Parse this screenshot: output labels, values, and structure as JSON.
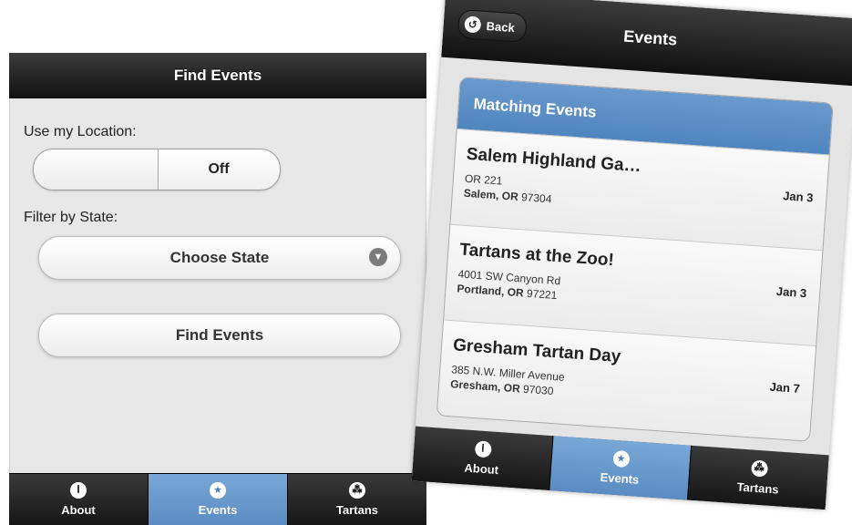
{
  "left_screen": {
    "header_title": "Find Events",
    "location_label": "Use my Location:",
    "location_toggle_state": "Off",
    "state_label": "Filter by State:",
    "state_select_value": "Choose State",
    "find_button_label": "Find Events",
    "tabs": [
      {
        "label": "About",
        "icon": "info-icon",
        "active": false
      },
      {
        "label": "Events",
        "icon": "star-icon",
        "active": true
      },
      {
        "label": "Tartans",
        "icon": "grid-icon",
        "active": false
      }
    ]
  },
  "right_screen": {
    "back_label": "Back",
    "header_title": "Events",
    "list_header": "Matching Events",
    "events": [
      {
        "title": "Salem Highland Ga…",
        "address": "OR 221",
        "city": "Salem, OR",
        "zip": "97304",
        "date": "Jan 3"
      },
      {
        "title": "Tartans at the Zoo!",
        "address": "4001 SW Canyon Rd",
        "city": "Portland, OR",
        "zip": "97221",
        "date": "Jan 3"
      },
      {
        "title": "Gresham Tartan Day",
        "address": "385 N.W. Miller Avenue",
        "city": "Gresham, OR",
        "zip": "97030",
        "date": "Jan 7"
      }
    ],
    "tabs": [
      {
        "label": "About",
        "icon": "info-icon",
        "active": false
      },
      {
        "label": "Events",
        "icon": "star-icon",
        "active": true
      },
      {
        "label": "Tartans",
        "icon": "grid-icon",
        "active": false
      }
    ]
  },
  "colors": {
    "accent_blue": "#5a8cc3",
    "header_dark": "#1a1a1a",
    "background_gray": "#e7e7e7"
  }
}
